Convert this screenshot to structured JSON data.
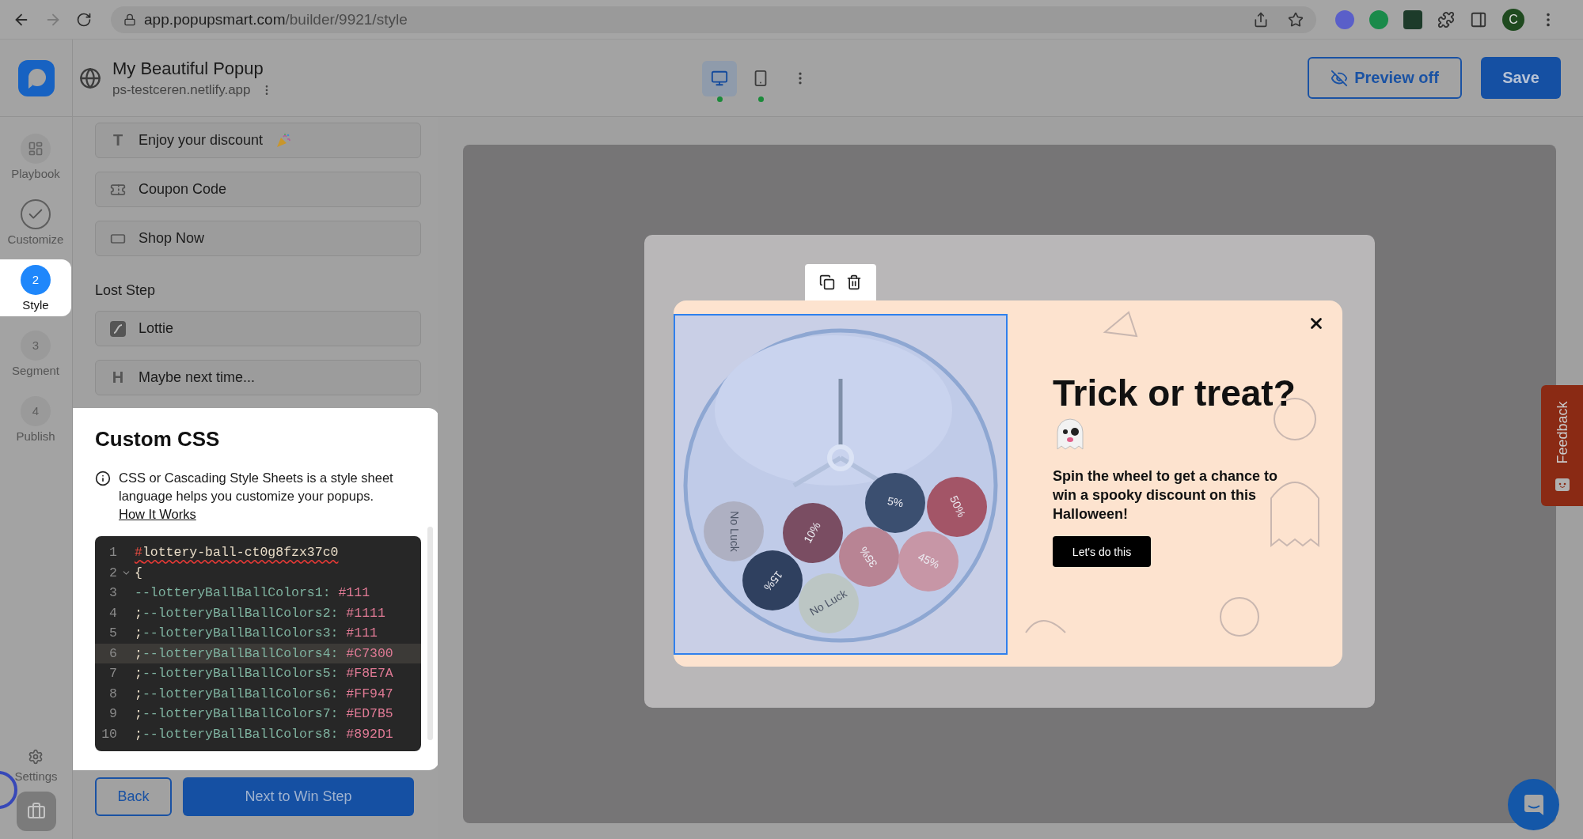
{
  "browser": {
    "nav": [
      {
        "kind": "back",
        "disabled": false
      },
      {
        "kind": "forward",
        "disabled": true
      },
      {
        "kind": "reload",
        "disabled": false
      }
    ],
    "url_host": "app.popupsmart.com",
    "url_path": "/builder/9921/style",
    "profile_initial": "C"
  },
  "header": {
    "title": "My Beautiful Popup",
    "site": "ps-testceren.netlify.app",
    "devices": [
      {
        "kind": "desktop",
        "selected": true
      },
      {
        "kind": "mobile",
        "selected": false
      }
    ],
    "preview_button": "Preview off",
    "save_button": "Save"
  },
  "rail": {
    "steps": [
      {
        "kind": "icon",
        "label": "Playbook",
        "selected": false
      },
      {
        "kind": "icon",
        "label": "Customize",
        "selected": false
      },
      {
        "kind": "number",
        "number": "2",
        "label": "Style",
        "selected": true
      },
      {
        "kind": "number",
        "number": "3",
        "label": "Segment",
        "selected": false
      },
      {
        "kind": "number",
        "number": "4",
        "label": "Publish",
        "selected": false
      }
    ],
    "settings": "Settings"
  },
  "panel": {
    "groups": [
      {
        "items": [
          {
            "kind": "text",
            "glyph": "T",
            "label": "Enjoy your discount"
          },
          {
            "kind": "coupon",
            "label": "Coupon Code"
          },
          {
            "kind": "button",
            "label": "Shop Now"
          }
        ]
      },
      {
        "title": "Lost Step",
        "items": [
          {
            "kind": "lottie",
            "label": "Lottie"
          },
          {
            "kind": "heading",
            "glyph": "H",
            "label": "Maybe next time..."
          }
        ]
      }
    ]
  },
  "custom_css": {
    "title": "Custom CSS",
    "description": "CSS or Cascading Style Sheets is a style sheet language helps you customize your popups.",
    "link": "How It Works",
    "code": [
      {
        "number": "1",
        "kind": "selector",
        "text": "#lottery-ball-ct0g8fzx37c0",
        "error": true,
        "highlighted": false
      },
      {
        "number": "2",
        "kind": "brace",
        "text": "{",
        "foldable": true,
        "highlighted": false
      },
      {
        "number": "3",
        "kind": "property",
        "property": "--lotteryBallBallColors1:",
        "value": "#111",
        "highlighted": false
      },
      {
        "number": "4",
        "kind": "property",
        "prefix": ";",
        "property": "--lotteryBallBallColors2:",
        "value": "#1111",
        "highlighted": false
      },
      {
        "number": "5",
        "kind": "property",
        "prefix": ";",
        "property": "--lotteryBallBallColors3:",
        "value": "#111",
        "highlighted": false
      },
      {
        "number": "6",
        "kind": "property",
        "prefix": ";",
        "property": "--lotteryBallBallColors4:",
        "value": "#C7300",
        "highlighted": true
      },
      {
        "number": "7",
        "kind": "property",
        "prefix": ";",
        "property": "--lotteryBallBallColors5:",
        "value": "#F8E7A",
        "highlighted": false
      },
      {
        "number": "8",
        "kind": "property",
        "prefix": ";",
        "property": "--lotteryBallBallColors6:",
        "value": "#FF947",
        "highlighted": false
      },
      {
        "number": "9",
        "kind": "property",
        "prefix": ";",
        "property": "--lotteryBallBallColors7:",
        "value": "#ED7B5",
        "highlighted": false
      },
      {
        "number": "10",
        "kind": "property",
        "prefix": ";",
        "property": "--lotteryBallBallColors8:",
        "value": "#892D1",
        "highlighted": false
      }
    ]
  },
  "footer": {
    "back": "Back",
    "next": "Next to Win Step"
  },
  "popup": {
    "heading": "Trick or treat?",
    "body": "Spin the wheel to get a chance to win a spooky discount on this Halloween!",
    "cta": "Let's do this",
    "balls": [
      {
        "label": "No Luck",
        "color": "#aeb0c2"
      },
      {
        "label": "10%",
        "color": "#7a4d62"
      },
      {
        "label": "5%",
        "color": "#3b4f70"
      },
      {
        "label": "50%",
        "color": "#a35567"
      },
      {
        "label": "35%",
        "color": "#b88494"
      },
      {
        "label": "45%",
        "color": "#c796a6"
      },
      {
        "label": "15%",
        "color": "#2f405f"
      },
      {
        "label": "No Luck",
        "color": "#bcc6c4"
      }
    ]
  },
  "feedback": "Feedback"
}
